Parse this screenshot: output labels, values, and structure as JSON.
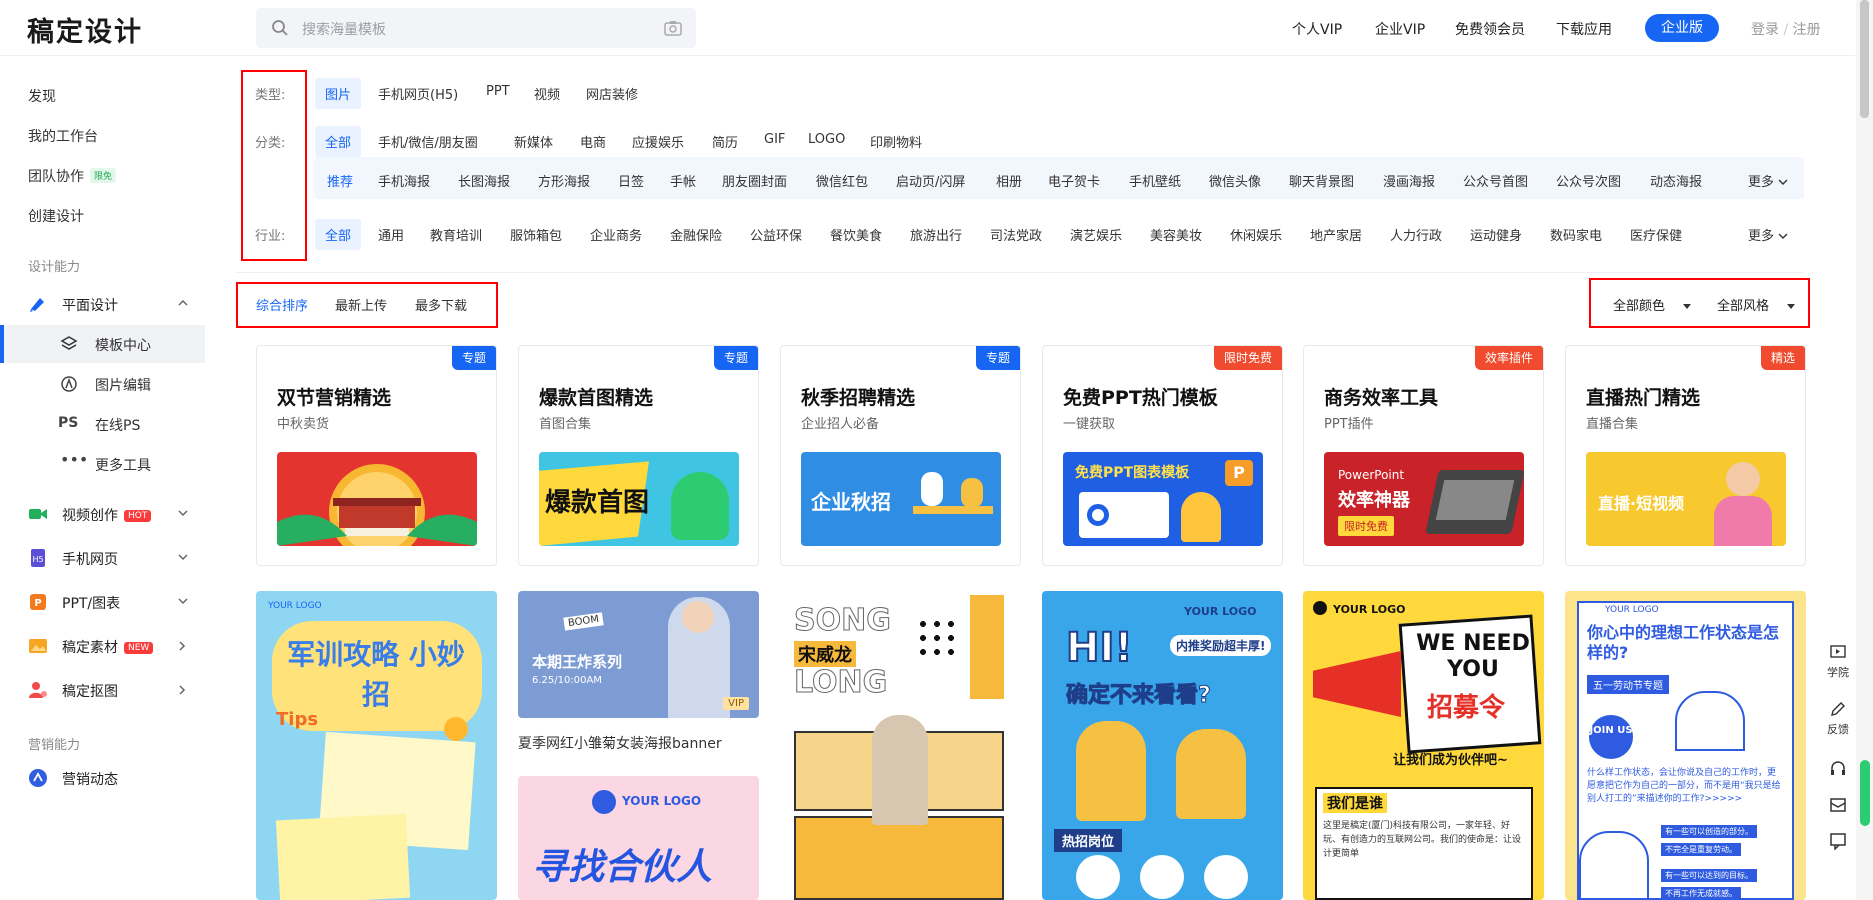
{
  "header": {
    "logo": "稿定设计",
    "search_placeholder": "搜索海量模板",
    "nav": [
      "个人VIP",
      "企业VIP",
      "免费领会员",
      "下载应用"
    ],
    "enterprise_btn": "企业版",
    "login": "登录",
    "register": "注册",
    "login_sep": "/"
  },
  "sidebar": {
    "discover": "发现",
    "workspace": "我的工作台",
    "team": "团队协作",
    "team_badge": "限免",
    "create": "创建设计",
    "design_section": "设计能力",
    "graphic": "平面设计",
    "template_center": "模板中心",
    "image_edit": "图片编辑",
    "online_ps": "在线PS",
    "more_tools": "更多工具",
    "video": "视频创作",
    "video_badge": "HOT",
    "h5": "手机网页",
    "ppt": "PPT/图表",
    "material": "稿定素材",
    "material_badge": "NEW",
    "cutout": "稿定抠图",
    "marketing_section": "营销能力",
    "marketing": "营销动态"
  },
  "filters": {
    "type_label": "类型:",
    "types": [
      "图片",
      "手机网页(H5)",
      "PPT",
      "视频",
      "网店装修"
    ],
    "cat_label": "分类:",
    "cats": [
      "全部",
      "手机/微信/朋友圈",
      "新媒体",
      "电商",
      "应援娱乐",
      "简历",
      "GIF",
      "LOGO",
      "印刷物料"
    ],
    "subcats": [
      "推荐",
      "手机海报",
      "长图海报",
      "方形海报",
      "日签",
      "手帐",
      "朋友圈封面",
      "微信红包",
      "启动页/闪屏",
      "相册",
      "电子贺卡",
      "手机壁纸",
      "微信头像",
      "聊天背景图",
      "漫画海报",
      "公众号首图",
      "公众号次图",
      "动态海报"
    ],
    "industry_label": "行业:",
    "industries": [
      "全部",
      "通用",
      "教育培训",
      "服饰箱包",
      "企业商务",
      "金融保险",
      "公益环保",
      "餐饮美食",
      "旅游出行",
      "司法党政",
      "演艺娱乐",
      "美容美妆",
      "休闲娱乐",
      "地产家居",
      "人力行政",
      "运动健身",
      "数码家电",
      "医疗保健"
    ],
    "more": "更多"
  },
  "sort": {
    "options": [
      "综合排序",
      "最新上传",
      "最多下载"
    ],
    "color": "全部颜色",
    "style": "全部风格"
  },
  "cards": [
    {
      "tag": "专题",
      "tag_color": "#1766f3",
      "title": "双节营销精选",
      "sub": "中秋卖货"
    },
    {
      "tag": "专题",
      "tag_color": "#1766f3",
      "title": "爆款首图精选",
      "sub": "首图合集",
      "img_text": "爆款首图"
    },
    {
      "tag": "专题",
      "tag_color": "#1766f3",
      "title": "秋季招聘精选",
      "sub": "企业招人必备",
      "img_text": "企业秋招"
    },
    {
      "tag": "限时免费",
      "tag_color": "#f04b2f",
      "title": "免费PPT热门模板",
      "sub": "一键获取",
      "img_text": "免费PPT图表模板"
    },
    {
      "tag": "效率插件",
      "tag_color": "#f04b2f",
      "title": "商务效率工具",
      "sub": "PPT插件",
      "img_text1": "PowerPoint",
      "img_text2": "效率神器",
      "img_text3": "限时免费"
    },
    {
      "tag": "精选",
      "tag_color": "#f04b2f",
      "title": "直播热门精选",
      "sub": "直播合集",
      "img_text": "直播·短视频"
    }
  ],
  "templates": {
    "t1_logo": "YOUR LOGO",
    "t1_title": "军训攻略 小妙招",
    "t1_tips": "Tips",
    "t2_boom": "BOOM",
    "t2_title": "本期王炸系列",
    "t2_date": "6.25/10:00AM",
    "t2_vip": "VIP",
    "t2_caption": "夏季网红小雏菊女装海报banner",
    "t3_logo": "YOUR LOGO",
    "t3_title": "寻找合伙人",
    "t4_song": "SONG",
    "t4_name": "宋威龙",
    "t4_long": "LONG",
    "t5_logo": "YOUR LOGO",
    "t5_hi": "HI!",
    "t5_badge": "内推奖励超丰厚!",
    "t5_title": "确定不来看看?",
    "t5_jobs": "热招岗位",
    "t6_logo": "YOUR LOGO",
    "t6_need": "WE NEED YOU",
    "t6_recruit": "招募令",
    "t6_slogan": "让我们成为伙伴吧~",
    "t6_who": "我们是谁",
    "t6_body": "这里是稿定(厦门)科技有限公司，一家年轻、好玩、有创造力的互联网公司。我们的使命是：让设计更简单",
    "t7_logo": "YOUR LOGO",
    "t7_title": "你心中的理想工作状态是怎样的?",
    "t7_sub": "五一劳动节专题",
    "t7_join": "JOIN US",
    "t7_body": "什么样工作状态，会让你说及自己的工作时，更愿意把它作为自己的一部分，而不是用“我只是给别人打工的”来描述你的工作?>>>>>",
    "t7_c1": "有一些可以创造的部分。",
    "t7_c2": "不完全是重复劳动。",
    "t7_c3": "有一些可以达到的目标。",
    "t7_c4": "不再工作无成就感。"
  },
  "right_tools": [
    "学院",
    "反馈"
  ]
}
